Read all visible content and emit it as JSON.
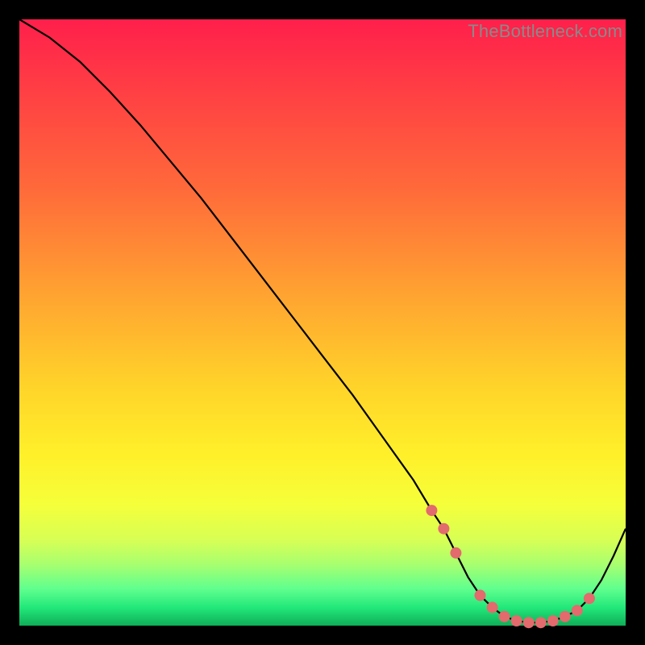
{
  "attribution": "TheBottleneck.com",
  "colors": {
    "frame": "#000000",
    "gradient_top": "#ff1f4b",
    "gradient_mid": "#fff02a",
    "gradient_bottom": "#0fae57",
    "curve": "#000000",
    "markers": "#e36a6d"
  },
  "chart_data": {
    "type": "line",
    "title": "",
    "xlabel": "",
    "ylabel": "",
    "xlim": [
      0,
      100
    ],
    "ylim": [
      0,
      100
    ],
    "annotations": [],
    "series": [
      {
        "name": "bottleneck-curve",
        "x": [
          0,
          5,
          10,
          15,
          20,
          25,
          30,
          35,
          40,
          45,
          50,
          55,
          60,
          65,
          68,
          70,
          72,
          74,
          76,
          78,
          80,
          82,
          84,
          86,
          88,
          90,
          92,
          94,
          96,
          98,
          100
        ],
        "values": [
          100,
          97,
          93,
          88,
          82.5,
          76.5,
          70.5,
          64,
          57.5,
          51,
          44.5,
          38,
          31,
          24,
          19,
          16,
          12,
          8,
          5,
          3,
          1.5,
          0.8,
          0.5,
          0.5,
          0.8,
          1.5,
          2.5,
          4.5,
          7.5,
          11.5,
          16
        ]
      }
    ],
    "markers": {
      "name": "highlight-points",
      "x": [
        68,
        70,
        72,
        76,
        78,
        80,
        82,
        84,
        86,
        88,
        90,
        92,
        94
      ],
      "values": [
        19,
        16,
        12,
        5,
        3,
        1.5,
        0.8,
        0.5,
        0.5,
        0.8,
        1.5,
        2.5,
        4.5
      ]
    }
  }
}
